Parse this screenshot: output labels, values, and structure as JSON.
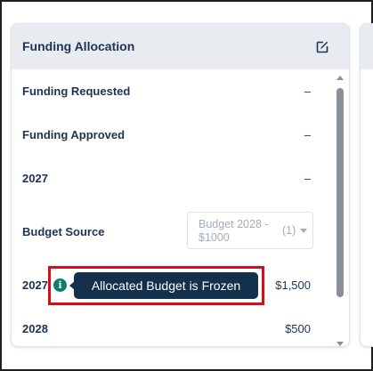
{
  "card": {
    "title": "Funding Allocation",
    "edit_icon": "edit-icon"
  },
  "rows": [
    {
      "label": "Funding Requested",
      "value": "–"
    },
    {
      "label": "Funding Approved",
      "value": "–"
    },
    {
      "label": "2027",
      "value": "–"
    },
    {
      "label": "Budget Source",
      "value": ""
    },
    {
      "label": "2027",
      "value": "$1,500"
    },
    {
      "label": "2028",
      "value": "$500"
    }
  ],
  "budget_source_select": {
    "selected": "Budget 2028 - $1000",
    "count": "(1)"
  },
  "tooltip": {
    "text": "Allocated Budget is Frozen",
    "icon": "info-icon"
  },
  "colors": {
    "header_bg": "#e8ecf0",
    "text_primary": "#1d3354",
    "tooltip_bg": "#13304d",
    "info_icon": "#0e7c6b",
    "highlight": "#d0101b"
  }
}
